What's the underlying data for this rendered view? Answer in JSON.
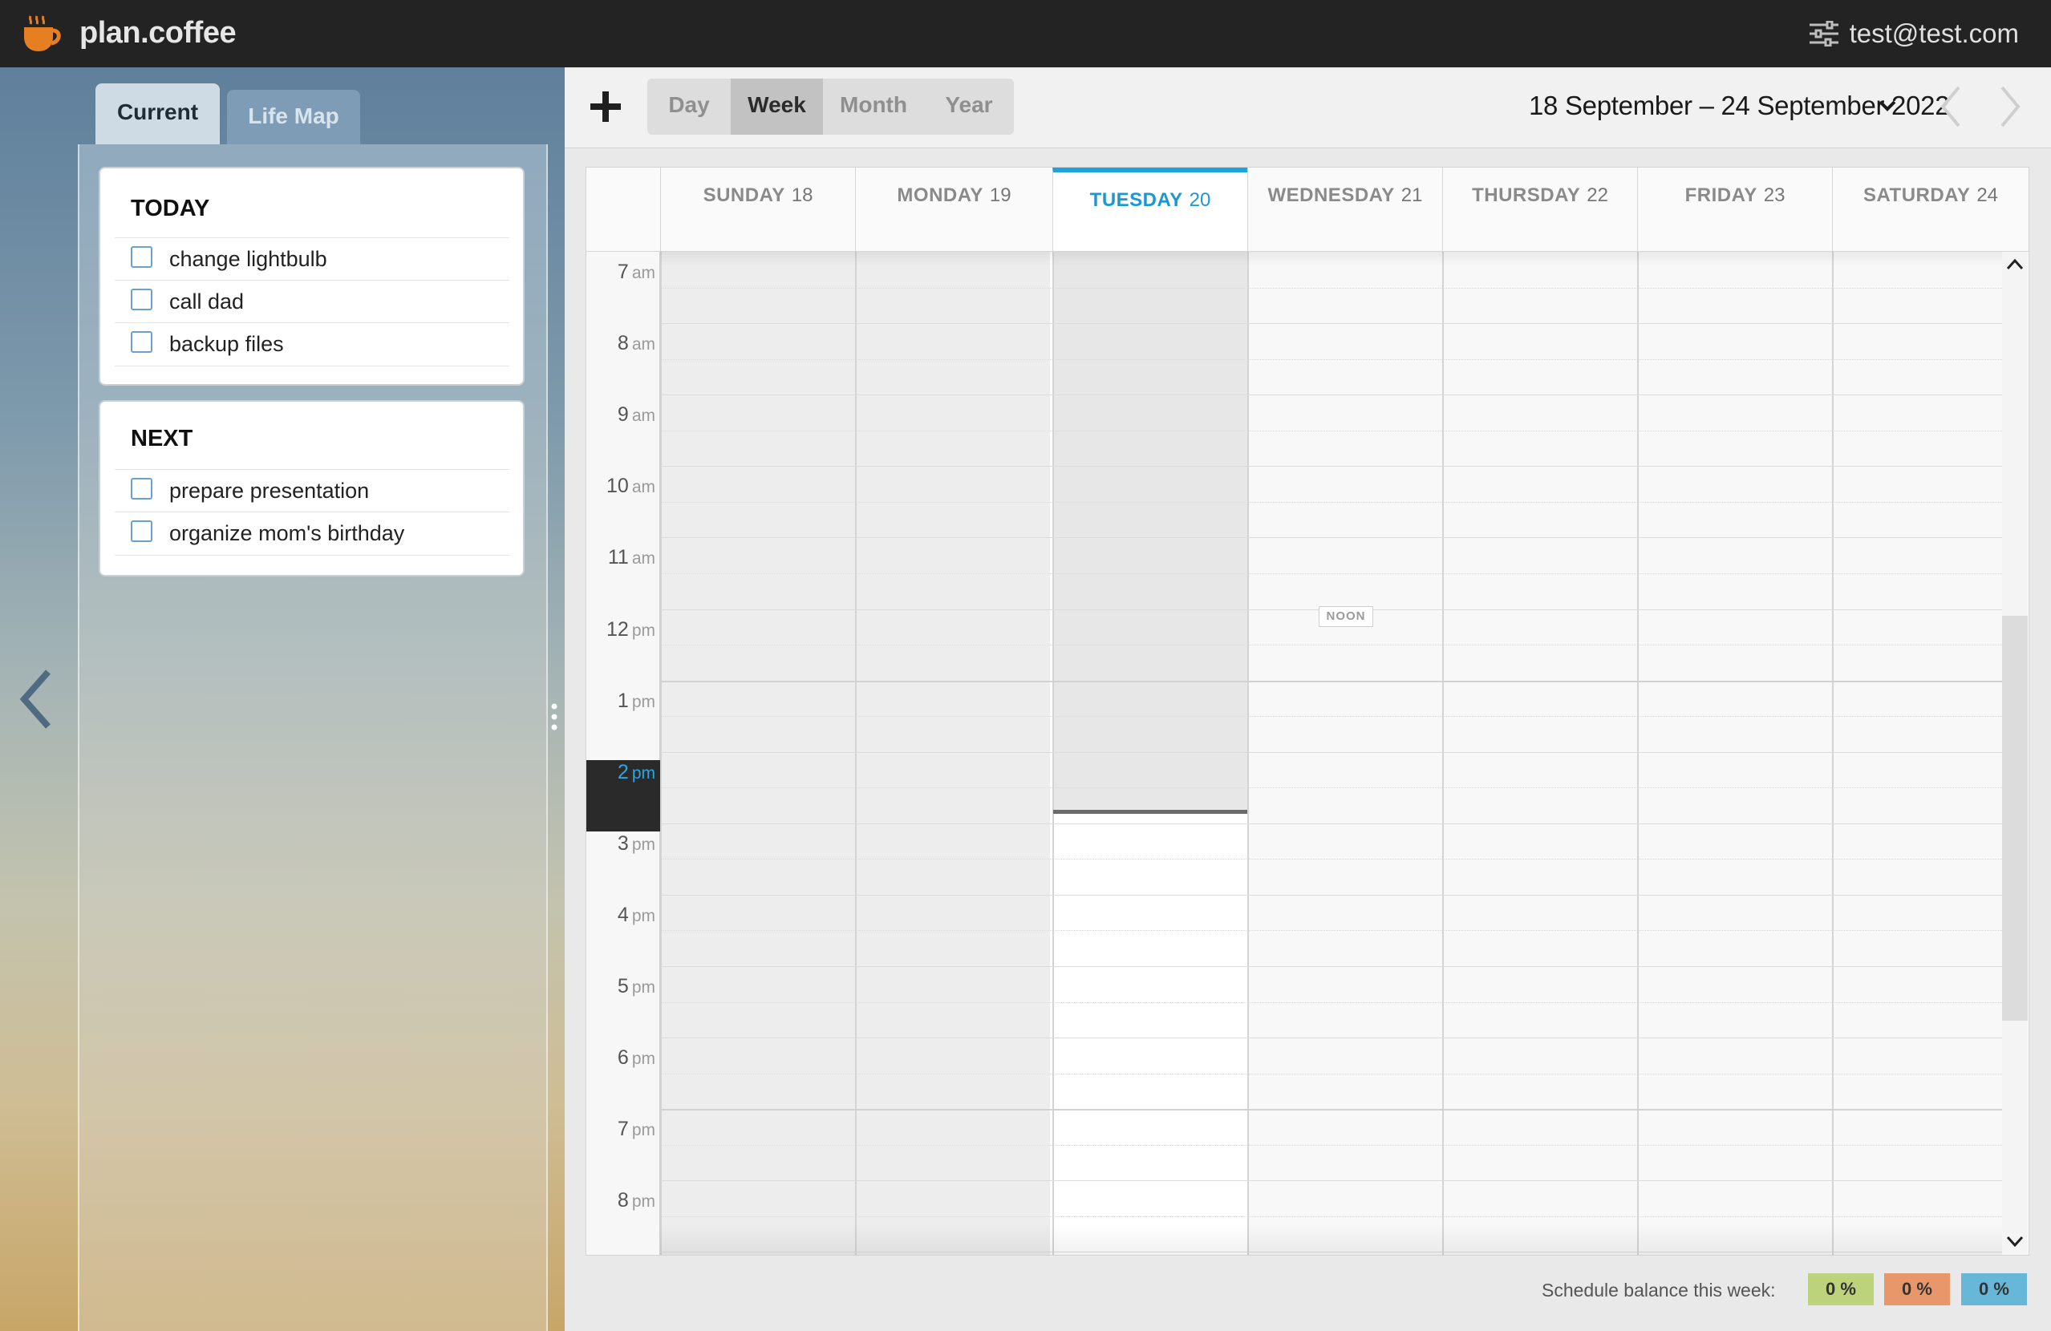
{
  "app": {
    "name": "plan.coffee",
    "user_email": "test@test.com"
  },
  "sidebar": {
    "tabs": [
      {
        "label": "Current",
        "active": true
      },
      {
        "label": "Life Map",
        "active": false
      }
    ],
    "sections": [
      {
        "title": "TODAY",
        "tasks": [
          "change lightbulb",
          "call dad",
          "backup files"
        ]
      },
      {
        "title": "NEXT",
        "tasks": [
          "prepare presentation",
          "organize mom's birthday"
        ]
      }
    ]
  },
  "toolbar": {
    "views": [
      {
        "label": "Day",
        "active": false
      },
      {
        "label": "Week",
        "active": true
      },
      {
        "label": "Month",
        "active": false
      },
      {
        "label": "Year",
        "active": false
      }
    ],
    "date_range": "18 September – 24 September 2022"
  },
  "calendar": {
    "days": [
      {
        "name": "SUNDAY",
        "num": "18",
        "today": false
      },
      {
        "name": "MONDAY",
        "num": "19",
        "today": false
      },
      {
        "name": "TUESDAY",
        "num": "20",
        "today": true
      },
      {
        "name": "WEDNESDAY",
        "num": "21",
        "today": false
      },
      {
        "name": "THURSDAY",
        "num": "22",
        "today": false
      },
      {
        "name": "FRIDAY",
        "num": "23",
        "today": false
      },
      {
        "name": "SATURDAY",
        "num": "24",
        "today": false
      }
    ],
    "hours": [
      {
        "h": "7",
        "s": "am"
      },
      {
        "h": "8",
        "s": "am"
      },
      {
        "h": "9",
        "s": "am"
      },
      {
        "h": "10",
        "s": "am"
      },
      {
        "h": "11",
        "s": "am"
      },
      {
        "h": "12",
        "s": "pm"
      },
      {
        "h": "1",
        "s": "pm"
      },
      {
        "h": "2",
        "s": "pm",
        "current": true
      },
      {
        "h": "3",
        "s": "pm"
      },
      {
        "h": "4",
        "s": "pm"
      },
      {
        "h": "5",
        "s": "pm"
      },
      {
        "h": "6",
        "s": "pm"
      },
      {
        "h": "7",
        "s": "pm"
      },
      {
        "h": "8",
        "s": "pm"
      }
    ],
    "noon_label": "NOON"
  },
  "footer": {
    "balance_label": "Schedule balance this week:",
    "balances": [
      "0 %",
      "0 %",
      "0 %"
    ]
  },
  "colors": {
    "accent": "#1fa3dc",
    "topbar": "#232323",
    "logo": "#e67e22",
    "balance_green": "#bcd37c",
    "balance_orange": "#e8976a",
    "balance_blue": "#67b8d8"
  },
  "icons": {
    "logo": "coffee-cup-icon",
    "settings": "sliders-icon",
    "collapse": "chevron-left-icon",
    "add": "plus-icon",
    "date_dropdown": "chevron-down-icon",
    "prev": "chevron-left-icon",
    "next": "chevron-right-icon"
  }
}
